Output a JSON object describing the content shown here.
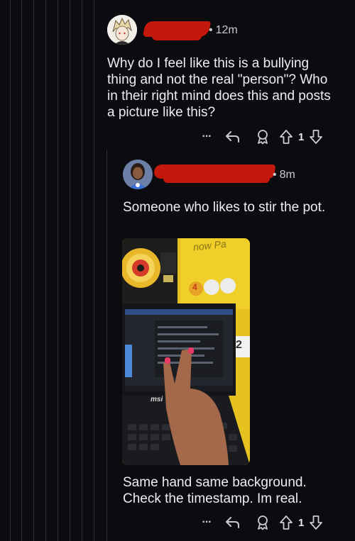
{
  "comments": [
    {
      "time": "12m",
      "body": "Why do I feel like this is a bullying thing and not the real \"person\"? Who in their right mind does this and posts a picture like this?",
      "votes": "1",
      "more_label": "···"
    },
    {
      "time": "8m",
      "body_top": "Someone who likes to stir the pot.",
      "body_bottom": "Same hand same background. Check the timestamp. Im real.",
      "votes": "1",
      "more_label": "···",
      "photo": {
        "wall_text": "now Pa",
        "sticker_numbers": [
          "4",
          "2"
        ],
        "laptop_brand": "msi"
      }
    }
  ],
  "colors": {
    "background": "#0b0c10",
    "redaction": "#c4180c",
    "text": "#eceef0",
    "thread_line": "#2e3036"
  },
  "icons": [
    "more-icon",
    "reply-icon",
    "award-icon",
    "upvote-icon",
    "downvote-icon"
  ]
}
